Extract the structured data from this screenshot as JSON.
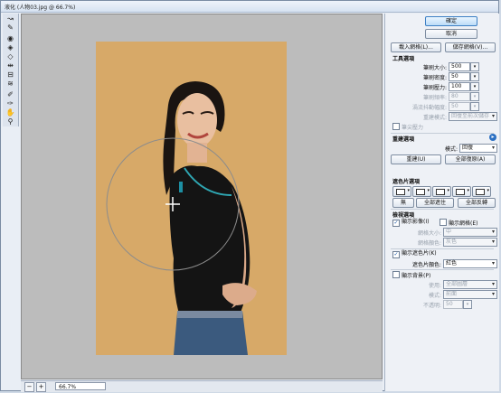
{
  "window": {
    "title": "液化 (人物03.jpg @ 66.7%)"
  },
  "toolbar": {
    "tools": [
      "forward-warp",
      "reconstruct",
      "twirl",
      "pucker",
      "bloat",
      "push-left",
      "mirror",
      "turbulence",
      "freeze-mask",
      "thaw-mask",
      "hand",
      "zoom"
    ]
  },
  "status": {
    "zoom": "66.7%",
    "minus": "−",
    "plus": "+"
  },
  "buttons": {
    "ok": "確定",
    "cancel": "取消",
    "load_mesh": "載入網格(L)...",
    "save_mesh": "儲存網格(V)...",
    "reconstruct": "重建(U)",
    "restore_all": "全部復原(A)",
    "none": "無",
    "mask_all": "全部遮住",
    "invert_all": "全部反轉"
  },
  "tool_options": {
    "heading": "工具選項",
    "brush_size_label": "筆刷大小:",
    "brush_size": "500",
    "brush_density_label": "筆刷密度:",
    "brush_density": "50",
    "brush_pressure_label": "筆刷壓力:",
    "brush_pressure": "100",
    "brush_rate_label": "筆刷頻率:",
    "brush_rate": "80",
    "turbulent_jitter_label": "渦流抖動幅度:",
    "turbulent_jitter": "50",
    "recon_mode_label": "重建模式:",
    "recon_mode": "回復至前次儲存",
    "stylus_pressure": "筆尖壓力"
  },
  "reconstruct_options": {
    "heading": "重建選項",
    "mode_label": "模式:",
    "mode": "回復"
  },
  "mask_options": {
    "heading": "遮色片選項"
  },
  "view_options": {
    "heading": "檢視選項",
    "show_image": "顯示影像(I)",
    "show_mesh": "顯示網格(E)",
    "mesh_size_label": "網格大小:",
    "mesh_size": "中",
    "mesh_color_label": "網格顏色:",
    "mesh_color": "灰色",
    "show_mask": "顯示遮色片(K)",
    "mask_color_label": "遮色片顏色:",
    "mask_color": "紅色",
    "show_backdrop": "顯示背景(P)",
    "use_label": "使用:",
    "use": "全部圖層",
    "mode_label": "模式:",
    "mode": "前面",
    "opacity_label": "不透明:",
    "opacity": "50"
  }
}
